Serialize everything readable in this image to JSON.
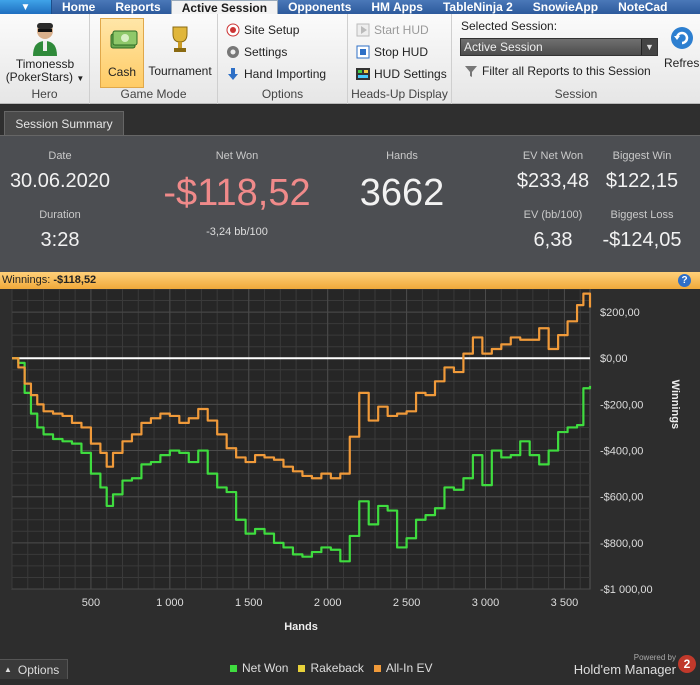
{
  "tabs": [
    "Home",
    "Reports",
    "Active Session",
    "Opponents",
    "HM Apps",
    "TableNinja 2",
    "SnowieApp",
    "NoteCad"
  ],
  "active_tab": "Active Session",
  "hero": {
    "name_line1": "Timonessb",
    "name_line2": "(PokerStars)",
    "group_label": "Hero"
  },
  "game_mode": {
    "cash_label": "Cash",
    "tournament_label": "Tournament",
    "group_label": "Game Mode"
  },
  "options": {
    "site_setup": "Site Setup",
    "settings": "Settings",
    "hand_importing": "Hand Importing",
    "group_label": "Options"
  },
  "hud": {
    "start": "Start HUD",
    "stop": "Stop HUD",
    "settings": "HUD Settings",
    "group_label": "Heads-Up Display"
  },
  "session": {
    "selected_label": "Selected Session:",
    "selected_value": "Active Session",
    "filter_label": "Filter all Reports to this Session",
    "refresh_label": "Refresh",
    "group_label": "Session"
  },
  "subtab": "Session Summary",
  "summary": {
    "date_label": "Date",
    "date_value": "30.06.2020",
    "duration_label": "Duration",
    "duration_value": "3:28",
    "net_won_label": "Net Won",
    "net_won_value": "-$118,52",
    "bb_per_100": "-3,24 bb/100",
    "hands_label": "Hands",
    "hands_value": "3662",
    "ev_net_won_label": "EV Net Won",
    "ev_net_won_value": "$233,48",
    "biggest_win_label": "Biggest Win",
    "biggest_win_value": "$122,15",
    "ev_bb_label": "EV (bb/100)",
    "ev_bb_value": "6,38",
    "biggest_loss_label": "Biggest Loss",
    "biggest_loss_value": "-$124,05"
  },
  "winnings_bar": {
    "label": "Winnings:",
    "value": "-$118,52",
    "help_icon": "?"
  },
  "chart_data": {
    "type": "line",
    "xlabel": "Hands",
    "ylabel": "Winnings",
    "xlim": [
      0,
      3662
    ],
    "ylim": [
      -1000,
      300
    ],
    "x_ticks": [
      500,
      1000,
      1500,
      2000,
      2500,
      3000,
      3500
    ],
    "x_tick_labels": [
      "500",
      "1 000",
      "1 500",
      "2 000",
      "2 500",
      "3 000",
      "3 500"
    ],
    "y_ticks": [
      200,
      0,
      -200,
      -400,
      -600,
      -800,
      -1000
    ],
    "y_tick_labels": [
      "$200,00",
      "$0,00",
      "-$200,00",
      "-$400,00",
      "-$600,00",
      "-$800,00",
      "-$1 000,00"
    ],
    "grid": true,
    "legend": "bottom",
    "series": [
      {
        "name": "Net Won",
        "color": "#3fdc3f",
        "x": [
          0,
          40,
          80,
          120,
          160,
          200,
          260,
          320,
          380,
          440,
          500,
          560,
          600,
          640,
          700,
          760,
          820,
          880,
          940,
          1000,
          1060,
          1120,
          1180,
          1240,
          1300,
          1360,
          1420,
          1480,
          1540,
          1600,
          1660,
          1720,
          1780,
          1840,
          1900,
          1960,
          2020,
          2080,
          2140,
          2200,
          2260,
          2320,
          2380,
          2440,
          2500,
          2560,
          2620,
          2680,
          2740,
          2800,
          2860,
          2920,
          2980,
          3040,
          3100,
          3160,
          3220,
          3280,
          3340,
          3400,
          3460,
          3520,
          3580,
          3620,
          3662
        ],
        "values": [
          0,
          -20,
          -150,
          -240,
          -300,
          -330,
          -350,
          -360,
          -370,
          -410,
          -500,
          -560,
          -640,
          -590,
          -530,
          -520,
          -460,
          -450,
          -420,
          -400,
          -410,
          -450,
          -400,
          -500,
          -560,
          -580,
          -700,
          -760,
          -740,
          -760,
          -800,
          -820,
          -850,
          -860,
          -840,
          -820,
          -830,
          -880,
          -770,
          -620,
          -720,
          -640,
          -660,
          -820,
          -780,
          -700,
          -680,
          -650,
          -560,
          -570,
          -520,
          -420,
          -550,
          -400,
          -430,
          -420,
          -360,
          -420,
          -460,
          -400,
          -320,
          -300,
          -290,
          -130,
          -120
        ]
      },
      {
        "name": "Rakeback",
        "color": "#e8d23a",
        "x": [],
        "values": []
      },
      {
        "name": "All-In EV",
        "color": "#f09a3a",
        "x": [
          0,
          40,
          80,
          120,
          160,
          200,
          260,
          320,
          380,
          440,
          500,
          560,
          600,
          640,
          700,
          760,
          820,
          880,
          940,
          1000,
          1060,
          1120,
          1180,
          1240,
          1300,
          1360,
          1420,
          1480,
          1540,
          1600,
          1660,
          1720,
          1780,
          1840,
          1900,
          1960,
          2020,
          2080,
          2140,
          2200,
          2260,
          2320,
          2380,
          2440,
          2500,
          2560,
          2620,
          2680,
          2740,
          2800,
          2860,
          2920,
          2980,
          3040,
          3100,
          3160,
          3220,
          3280,
          3340,
          3400,
          3460,
          3520,
          3580,
          3620,
          3662
        ],
        "values": [
          0,
          -40,
          -110,
          -160,
          -200,
          -230,
          -240,
          -250,
          -280,
          -300,
          -370,
          -410,
          -470,
          -410,
          -360,
          -330,
          -280,
          -260,
          -240,
          -250,
          -280,
          -260,
          -220,
          -270,
          -330,
          -390,
          -430,
          -450,
          -420,
          -430,
          -440,
          -470,
          -490,
          -510,
          -520,
          -500,
          -520,
          -500,
          -340,
          -150,
          -270,
          -210,
          -250,
          -240,
          -230,
          -150,
          -160,
          -100,
          -40,
          -60,
          20,
          90,
          20,
          40,
          60,
          90,
          80,
          80,
          130,
          40,
          100,
          160,
          230,
          280,
          220
        ]
      }
    ]
  },
  "footer": {
    "options_label": "Options",
    "powered_by": "Powered by",
    "brand_name": "Hold'em Manager",
    "brand_badge": "2"
  }
}
